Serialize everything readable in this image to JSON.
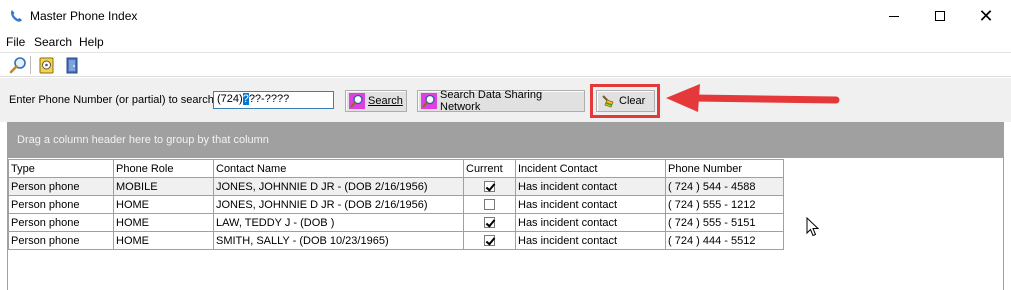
{
  "window": {
    "title": "Master Phone Index",
    "icon": "phone-handset-icon"
  },
  "menu": [
    "File",
    "Search",
    "Help"
  ],
  "toolbar": {
    "icons": [
      "magnifier-icon",
      "phone-book-icon",
      "exit-door-icon"
    ]
  },
  "search": {
    "label": "Enter Phone Number (or partial) to search:",
    "value_prefix": "(724)",
    "value_selected": "?",
    "value_suffix": "??-????",
    "search_label": "Search",
    "dsn_label": "Search Data Sharing Network",
    "clear_label": "Clear"
  },
  "grid": {
    "group_hint": "Drag a column header here to group by that column",
    "columns": [
      "Type",
      "Phone Role",
      "Contact Name",
      "Current",
      "Incident Contact",
      "Phone Number"
    ],
    "rows": [
      {
        "type": "Person phone",
        "role": "MOBILE",
        "name": "JONES, JOHNNIE D JR - (DOB 2/16/1956)",
        "current": true,
        "incident": "Has incident contact",
        "phone": "( 724 ) 544 - 4588"
      },
      {
        "type": "Person phone",
        "role": "HOME",
        "name": "JONES, JOHNNIE D JR - (DOB 2/16/1956)",
        "current": false,
        "incident": "Has incident contact",
        "phone": "( 724 ) 555 - 1212"
      },
      {
        "type": "Person phone",
        "role": "HOME",
        "name": "LAW, TEDDY J - (DOB )",
        "current": true,
        "incident": "Has incident contact",
        "phone": "( 724 ) 555 - 5151"
      },
      {
        "type": "Person phone",
        "role": "HOME",
        "name": "SMITH, SALLY - (DOB 10/23/1965)",
        "current": true,
        "incident": "Has incident contact",
        "phone": "( 724 ) 444 - 5512"
      }
    ]
  },
  "colors": {
    "annotation": "#e5383b",
    "group_bar": "#a0a0a0",
    "selection": "#0078d7"
  }
}
